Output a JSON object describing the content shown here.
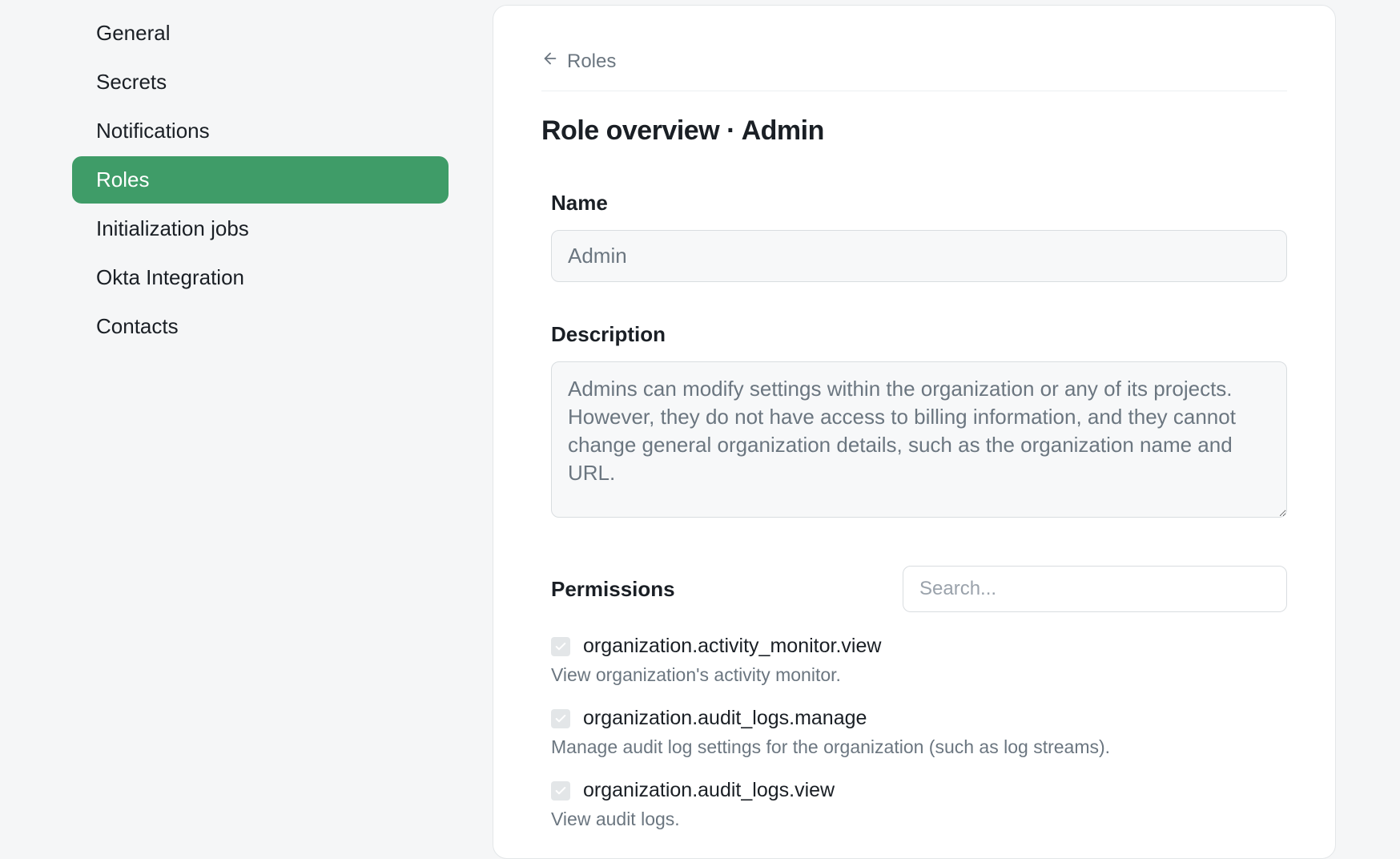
{
  "sidebar": {
    "items": [
      {
        "label": "General",
        "id": "general"
      },
      {
        "label": "Secrets",
        "id": "secrets"
      },
      {
        "label": "Notifications",
        "id": "notifications"
      },
      {
        "label": "Roles",
        "id": "roles"
      },
      {
        "label": "Initialization jobs",
        "id": "init-jobs"
      },
      {
        "label": "Okta Integration",
        "id": "okta"
      },
      {
        "label": "Contacts",
        "id": "contacts"
      }
    ],
    "active": "roles"
  },
  "breadcrumb": {
    "back_label": "Roles"
  },
  "page_title": "Role overview · Admin",
  "form": {
    "name_label": "Name",
    "name_value": "Admin",
    "description_label": "Description",
    "description_value": "Admins can modify settings within the organization or any of its projects. However, they do not have access to billing information, and they cannot change general organization details, such as the organization name and URL."
  },
  "permissions": {
    "label": "Permissions",
    "search_placeholder": "Search...",
    "items": [
      {
        "name": "organization.activity_monitor.view",
        "desc": "View organization's activity monitor.",
        "checked": true
      },
      {
        "name": "organization.audit_logs.manage",
        "desc": "Manage audit log settings for the organization (such as log streams).",
        "checked": true
      },
      {
        "name": "organization.audit_logs.view",
        "desc": "View audit logs.",
        "checked": true
      }
    ]
  }
}
